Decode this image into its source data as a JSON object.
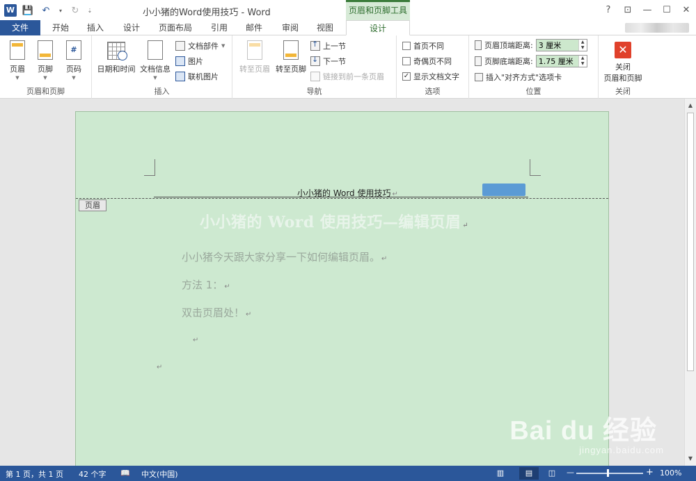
{
  "window": {
    "title": "小小猪的Word使用技巧 - Word",
    "context_tab_title": "页眉和页脚工具",
    "controls": {
      "help": "?",
      "restore_ribbon": "⊡",
      "minimize": "—",
      "maximize": "☐",
      "close": "✕"
    }
  },
  "qat": {
    "logo": "W",
    "save": "💾",
    "undo": "↶",
    "dropdown": "▾",
    "redo": "↻",
    "customize": "⇣"
  },
  "tabs": [
    "文件",
    "开始",
    "插入",
    "设计",
    "页面布局",
    "引用",
    "邮件",
    "审阅",
    "视图",
    "设计"
  ],
  "ribbon": {
    "header_footer_group": {
      "label": "页眉和页脚",
      "header": "页眉",
      "footer": "页脚",
      "page_number": "页码",
      "page_number_symbol": "#"
    },
    "insert_group": {
      "label": "插入",
      "datetime": "日期和时间",
      "docinfo": "文档信息",
      "quickparts": "文档部件",
      "picture": "图片",
      "online_picture": "联机图片"
    },
    "nav_group": {
      "label": "导航",
      "goto_header": "转至页眉",
      "goto_footer": "转至页脚",
      "prev": "上一节",
      "next": "下一节",
      "link_previous": "链接到前一条页眉"
    },
    "options_group": {
      "label": "选项",
      "different_first": "首页不同",
      "odd_even": "奇偶页不同",
      "show_text": "显示文档文字",
      "checked": "✓"
    },
    "position_group": {
      "label": "位置",
      "header_top": "页眉顶端距离:",
      "header_top_value": "3 厘米",
      "footer_bottom": "页脚底端距离:",
      "footer_bottom_value": "1.75 厘米",
      "insert_align_tab": "插入\"对齐方式\"选项卡"
    },
    "close_group": {
      "label": "关闭",
      "close_line1": "关闭",
      "close_line2": "页眉和页脚",
      "close_symbol": "✕"
    }
  },
  "document": {
    "header_text": "小小猪的 Word 使用技巧",
    "header_tag": "页眉",
    "title": "小小猪的 Word 使用技巧—编辑页眉",
    "paragraphs": [
      "小小猪今天跟大家分享一下如何编辑页眉。",
      "方法 1：",
      "双击页眉处！"
    ],
    "paragraph_mark": "↵"
  },
  "watermark": {
    "logo": "Bai du 经验",
    "sub": "jingyan.baidu.com"
  },
  "status": {
    "page": "第 1 页，共 1 页",
    "words": "42 个字",
    "proof_icon": "📖",
    "language": "中文(中国)",
    "zoom": "100%",
    "zoom_out": "—",
    "zoom_in": "+"
  }
}
